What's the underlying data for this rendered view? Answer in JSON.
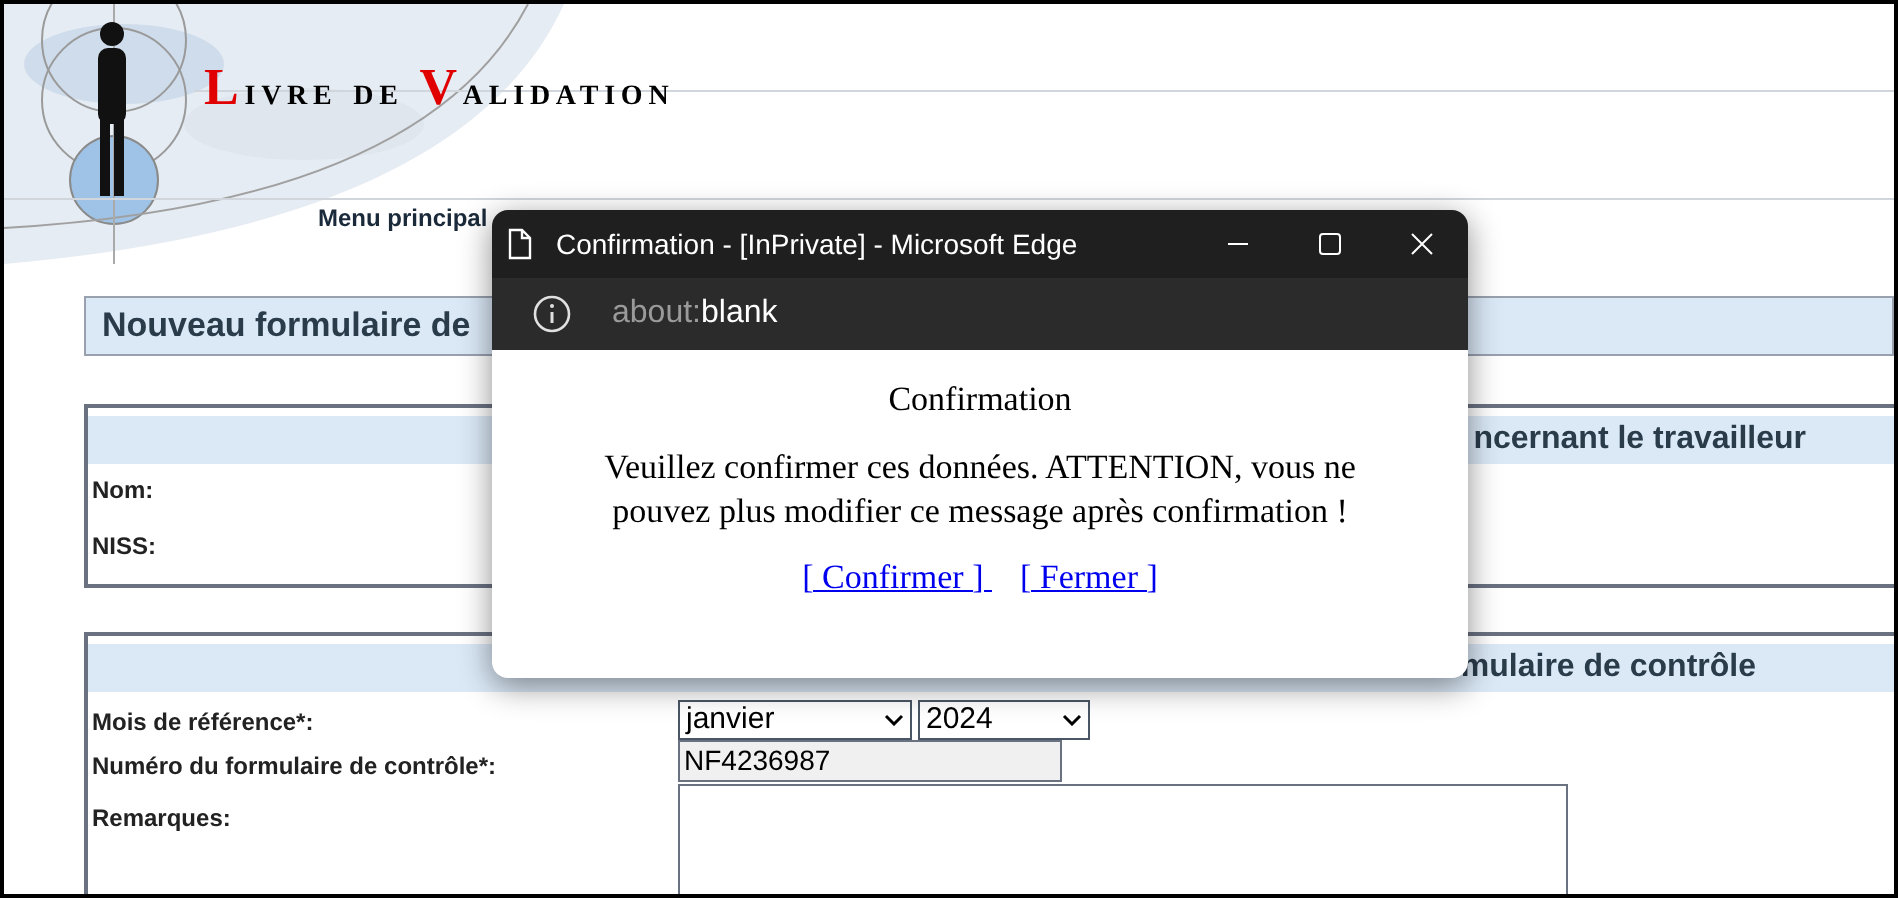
{
  "site": {
    "title_parts": [
      {
        "initial": "L",
        "rest": "ivre de "
      },
      {
        "initial": "V",
        "rest": "alidation"
      }
    ]
  },
  "menu": [
    {
      "label": "Menu principal"
    }
  ],
  "page_heading": "Nouveau formulaire de",
  "sections": [
    {
      "heading": "ncernant le travailleur",
      "fields": [
        {
          "kind": "label",
          "label": "Nom:"
        },
        {
          "kind": "label",
          "label": "NISS:"
        }
      ]
    },
    {
      "heading": "mulaire de contrôle",
      "fields": [
        {
          "kind": "selects",
          "label": "Mois de référence*:",
          "values": [
            "janvier",
            "2024"
          ]
        },
        {
          "kind": "input",
          "label": "Numéro du formulaire de contrôle*:",
          "value": "NF4236987"
        },
        {
          "kind": "textarea",
          "label": "Remarques:"
        }
      ]
    }
  ],
  "popup": {
    "window_title": "Confirmation - [InPrivate] - Microsoft Edge",
    "address_dim": "about:",
    "address": "blank",
    "title": "Confirmation",
    "message": "Veuillez confirmer ces données. ATTENTION, vous ne pouvez plus modifier ce message après confirmation !",
    "links": [
      "[ Confirmer ] ",
      "[ Fermer ]"
    ]
  }
}
